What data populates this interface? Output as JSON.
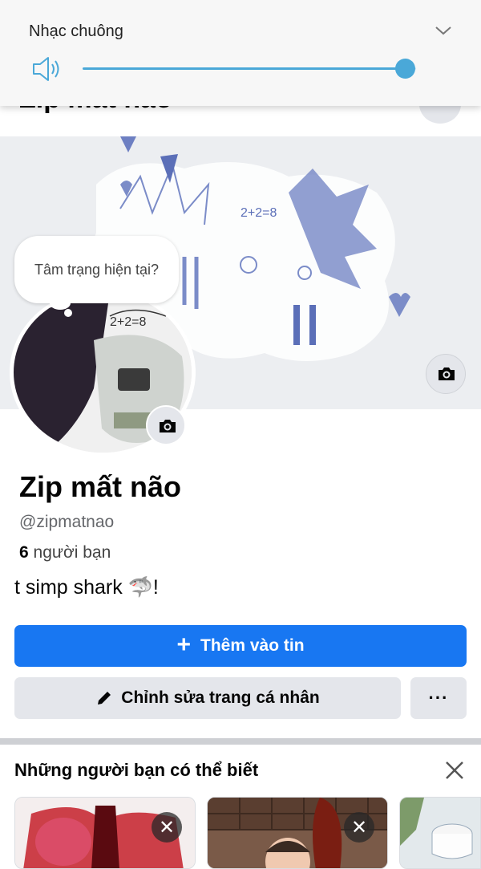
{
  "volume_panel": {
    "title": "Nhạc chuông",
    "level_percent": 97,
    "accent_color": "#4aa8d8",
    "icons": [
      "chevron-down-icon",
      "speaker-icon"
    ]
  },
  "header": {
    "peek_name": "Zip mất não"
  },
  "mood": {
    "text": "Tâm trạng hiện tại?"
  },
  "profile": {
    "name": "Zip mất não",
    "username": "@zipmatnao",
    "friends_count": "6",
    "friends_label": " người bạn",
    "bio": "t simp shark 🦈!"
  },
  "actions": {
    "add_story_plus": "+",
    "add_story_label": "Thêm vào tin",
    "edit_label": "Chỉnh sửa trang cá nhân",
    "more_label": "···",
    "primary_color": "#1877f2"
  },
  "pymk": {
    "title": "Những người bạn có thể biết",
    "dismiss_label": "✕"
  }
}
